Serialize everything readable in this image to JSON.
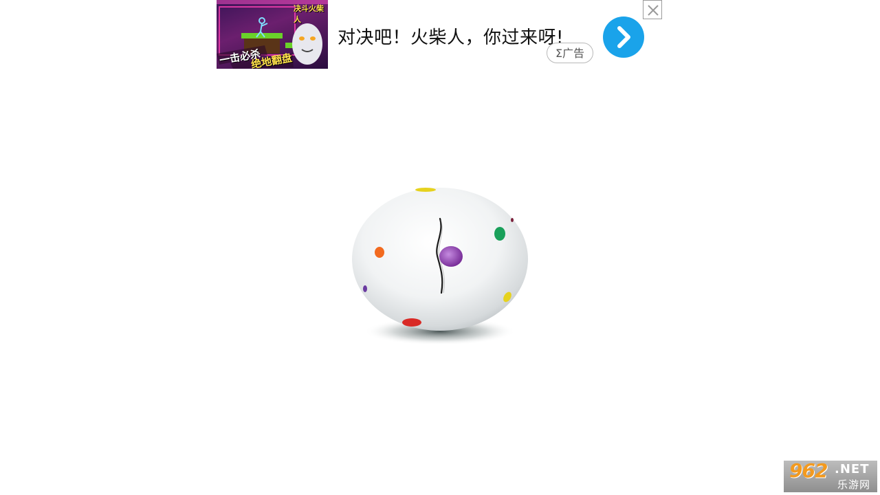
{
  "ad": {
    "thumbnail_texts": {
      "top_logo": "决斗火柴人",
      "line1": "一击必杀",
      "line2": "绝地翻盘"
    },
    "headline": "对决吧！火柴人，你过来呀!",
    "badge_label": "Σ广告",
    "go_icon": "chevron-right-icon",
    "close_icon": "close-icon",
    "accent_color": "#1aa3ea"
  },
  "egg": {
    "shell_color": "#f4f6f7",
    "crack": "single vertical crack",
    "spots": [
      "orange",
      "green",
      "purple",
      "yellow",
      "red"
    ]
  },
  "watermark": {
    "number": "962",
    "domain": ".NET",
    "subtitle": "乐游网",
    "color": "#f39a1f"
  }
}
